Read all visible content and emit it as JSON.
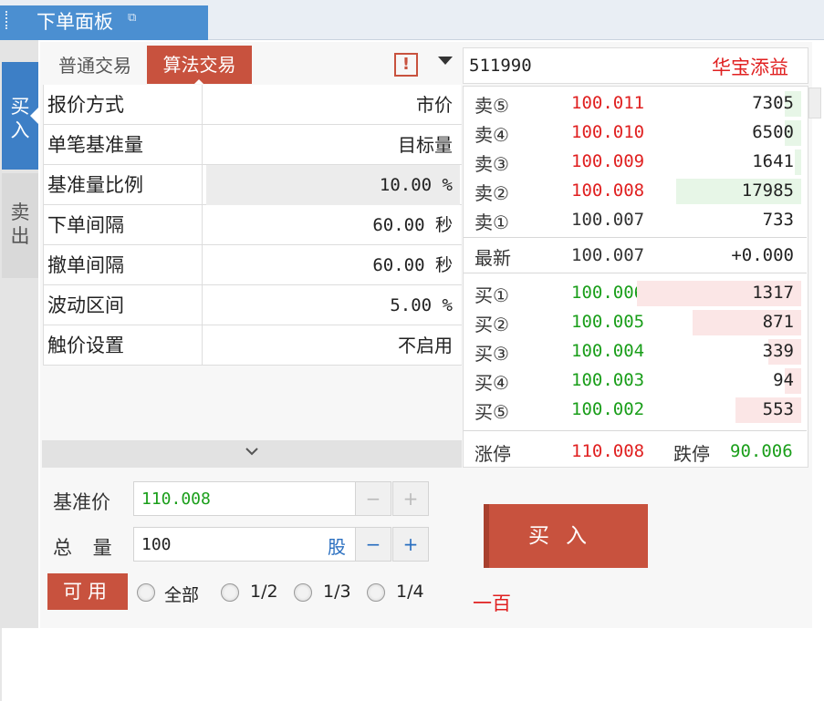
{
  "window": {
    "title": "下单面板"
  },
  "side_tabs": {
    "buy": "买入",
    "sell": "卖出"
  },
  "tabs": {
    "normal": "普通交易",
    "algo": "算法交易",
    "warning_icon": "!"
  },
  "params": [
    {
      "name": "报价方式",
      "value": "市价"
    },
    {
      "name": "单笔基准量",
      "value": "目标量"
    },
    {
      "name": "基准量比例",
      "value": "10.00 %"
    },
    {
      "name": "下单间隔",
      "value": "60.00 秒"
    },
    {
      "name": "撤单间隔",
      "value": "60.00 秒"
    },
    {
      "name": "波动区间",
      "value": "5.00 %"
    },
    {
      "name": "触价设置",
      "value": "不启用"
    }
  ],
  "quote": {
    "code": "511990",
    "name": "华宝添益",
    "asks": [
      {
        "label": "卖⑤",
        "price": "100.011",
        "volume": "7305",
        "bar_fraction": 0.05
      },
      {
        "label": "卖④",
        "price": "100.010",
        "volume": "6500",
        "bar_fraction": 0.05
      },
      {
        "label": "卖③",
        "price": "100.009",
        "volume": "1641",
        "bar_fraction": 0.02
      },
      {
        "label": "卖②",
        "price": "100.008",
        "volume": "17985",
        "bar_fraction": 0.38
      },
      {
        "label": "卖①",
        "price": "100.007",
        "volume": "733",
        "bar_fraction": 0.0
      }
    ],
    "last": {
      "label": "最新",
      "price": "100.007",
      "change": "+0.000"
    },
    "bids": [
      {
        "label": "买①",
        "price": "100.006",
        "volume": "1317",
        "bar_fraction": 0.5
      },
      {
        "label": "买②",
        "price": "100.005",
        "volume": "871",
        "bar_fraction": 0.33
      },
      {
        "label": "买③",
        "price": "100.004",
        "volume": "339",
        "bar_fraction": 0.1
      },
      {
        "label": "买④",
        "price": "100.003",
        "volume": "94",
        "bar_fraction": 0.05
      },
      {
        "label": "买⑤",
        "price": "100.002",
        "volume": "553",
        "bar_fraction": 0.2
      }
    ],
    "limit_up_label": "涨停",
    "limit_up": "110.008",
    "limit_down_label": "跌停",
    "limit_down": "90.006"
  },
  "form": {
    "base_price_label": "基准价",
    "base_price": "110.008",
    "qty_label": "总 量",
    "qty": "100",
    "qty_unit": "股",
    "minus": "−",
    "plus": "+",
    "available_label": "可用",
    "radios": [
      "全部",
      "1/2",
      "1/3",
      "1/4"
    ],
    "buy_button": "买入",
    "amount_in_words": "一百"
  },
  "colors": {
    "accent_red": "#c8523e",
    "price_up": "#e02020",
    "price_down": "#1a9e1a",
    "tab_blue": "#3d7fc6"
  }
}
